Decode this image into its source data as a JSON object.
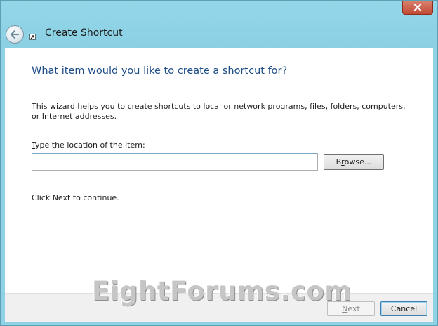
{
  "window": {
    "title": "Create Shortcut"
  },
  "wizard": {
    "heading": "What item would you like to create a shortcut for?",
    "description": "This wizard helps you to create shortcuts to local or network programs, files, folders, computers, or Internet addresses.",
    "location_label_mnemonic": "T",
    "location_label_rest": "ype the location of the item:",
    "location_value": "",
    "browse_mnemonic": "r",
    "browse_prefix": "B",
    "browse_suffix": "owse...",
    "continue_text": "Click Next to continue."
  },
  "footer": {
    "watermark": "EightForums.com",
    "next_mnemonic": "N",
    "next_rest": "ext",
    "cancel_label": "Cancel"
  },
  "icons": {
    "close": "close-icon",
    "back": "back-arrow-icon",
    "app": "shortcut-icon"
  },
  "colors": {
    "titlebar": "#8fd2e6",
    "heading": "#1f4d86",
    "close_button": "#c7503a"
  }
}
